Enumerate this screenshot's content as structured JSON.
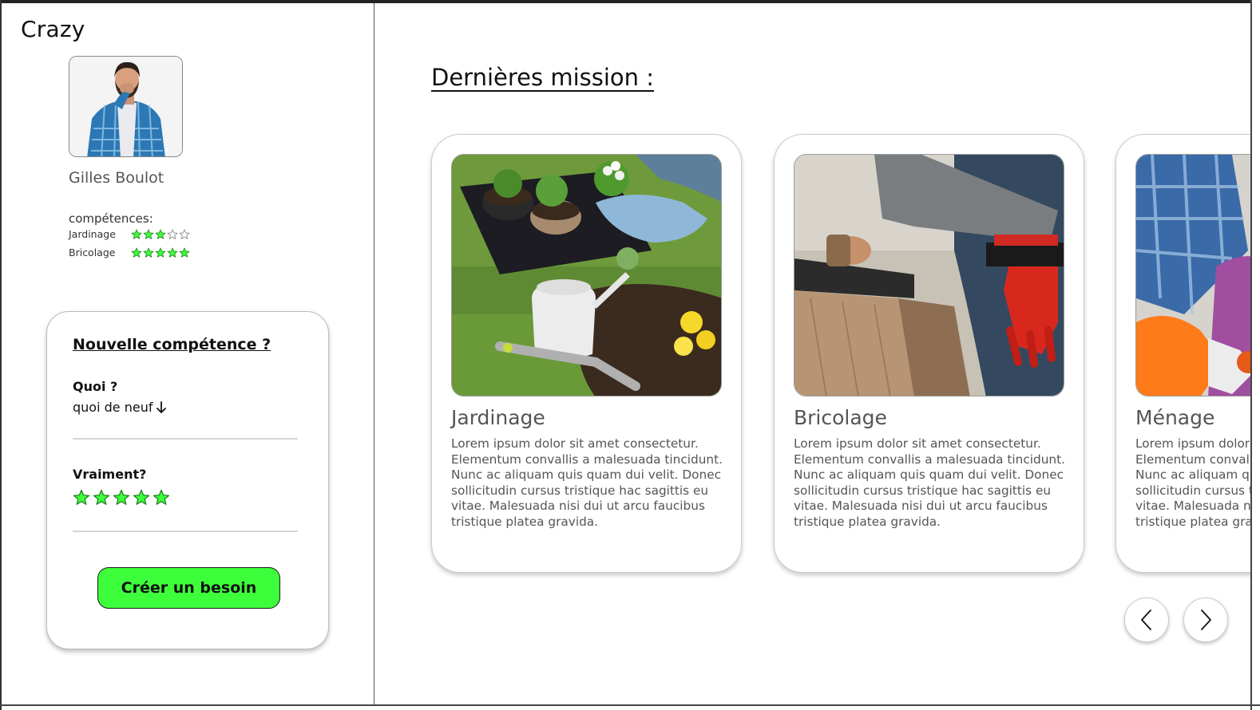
{
  "app": {
    "brand": "Crazy"
  },
  "profile": {
    "name": "Gilles Boulot",
    "skills_title": "compétences:",
    "skills": [
      {
        "label": "Jardinage",
        "rating": 3,
        "max": 5
      },
      {
        "label": "Bricolage",
        "rating": 5,
        "max": 5
      }
    ]
  },
  "new_skill": {
    "heading": "Nouvelle compétence ?",
    "what_label": "Quoi ?",
    "what_value": "quoi de neuf",
    "rating_label": "Vraiment?",
    "rating": 5,
    "rating_max": 5,
    "submit_label": "Créer un besoin"
  },
  "missions": {
    "title": "Dernières mission :",
    "items": [
      {
        "title": "Jardinage",
        "description": "Lorem ipsum dolor sit amet consectetur. Elementum convallis a malesuada tincidunt. Nunc ac aliquam quis quam dui velit. Donec sollicitudin cursus tristique hac sagittis eu vitae. Malesuada nisi dui ut arcu faucibus tristique platea gravida."
      },
      {
        "title": "Bricolage",
        "description": "Lorem ipsum dolor sit amet consectetur. Elementum convallis a malesuada tincidunt. Nunc ac aliquam quis quam dui velit. Donec sollicitudin cursus tristique hac sagittis eu vitae. Malesuada nisi dui ut arcu faucibus tristique platea gravida."
      },
      {
        "title": "Ménage",
        "description": "Lorem ipsum dolor sit amet consectetur. Elementum convallis a malesuada tincidunt. Nunc ac aliquam quis quam dui velit. Donec sollicitudin cursus tristique hac sagittis eu vitae. Malesuada nisi dui ut arcu faucibus tristique platea gravida."
      }
    ]
  },
  "carousel": {
    "prev_icon": "chevron-left-icon",
    "next_icon": "chevron-right-icon"
  },
  "colors": {
    "accent": "#3dfe3a",
    "star_fill": "#3dfe3a",
    "star_stroke": "#1a7a1a",
    "text_muted": "#555555"
  }
}
